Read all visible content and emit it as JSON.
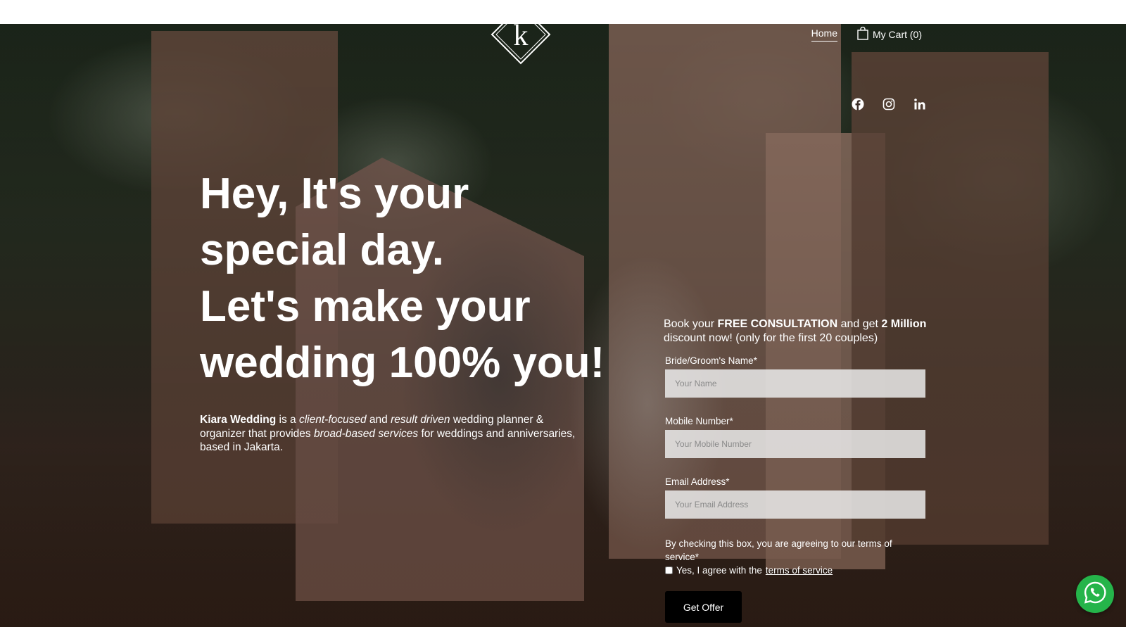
{
  "brand": {
    "logo_letter": "k"
  },
  "nav": {
    "home_label": "Home",
    "cart_label": "My Cart (0)"
  },
  "social": [
    "facebook-icon",
    "instagram-icon",
    "linkedin-icon"
  ],
  "hero": {
    "headline_lines": [
      "Hey, It's your",
      "special day.",
      "Let's make your",
      "wedding 100% you!"
    ],
    "intro": {
      "brand_name": "Kiara Wedding",
      "part1": " is a ",
      "em1": "client-focused",
      "part2": " and ",
      "em2": "result driven",
      "part3": " wedding planner & organizer that provides ",
      "em3": "broad-based services",
      "part4": " for weddings and anniversaries, based in Jakarta."
    }
  },
  "offer": {
    "prefix": "Book your ",
    "bold1": "FREE CONSULTATION",
    "middle": " and get ",
    "bold2": "2 Million",
    "suffix": " discount now! (only for the first 20 couples)"
  },
  "form": {
    "name_label": "Bride/Groom's Name*",
    "name_placeholder": "Your Name",
    "mobile_label": "Mobile Number*",
    "mobile_placeholder": "Your Mobile Number",
    "email_label": "Email Address*",
    "email_placeholder": "Your Email Address",
    "terms_note": "By checking this box, you are agreeing to our terms of service*",
    "agree_prefix": "Yes, I agree with the ",
    "agree_link": "terms of service",
    "submit_label": "Get Offer"
  },
  "colors": {
    "whatsapp": "#25b44a",
    "button": "#000000",
    "text": "#ffffff"
  }
}
